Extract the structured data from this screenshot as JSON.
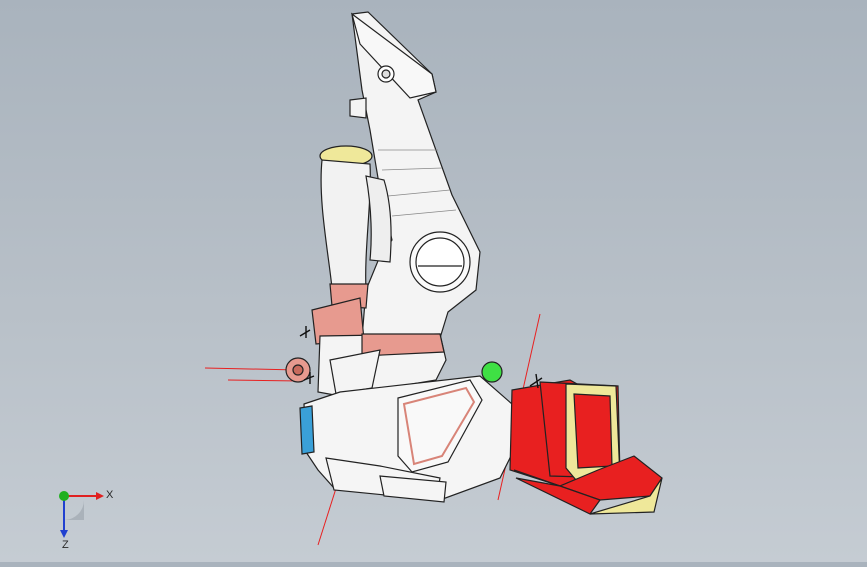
{
  "viewport": {
    "background_top": "#a9b3bd",
    "background_bottom": "#c5ccd3",
    "model_colors": {
      "body": "#f4f4f4",
      "edge": "#222222",
      "accent_red": "#e82020",
      "accent_salmon": "#e79a8f",
      "accent_green": "#3fe044",
      "accent_yellow": "#efe89a",
      "accent_blue": "#3aa0d8"
    }
  },
  "triad": {
    "x_label": "X",
    "z_label": "Z",
    "x_color": "#e02020",
    "y_color": "#20b020",
    "z_color": "#2040d0"
  }
}
